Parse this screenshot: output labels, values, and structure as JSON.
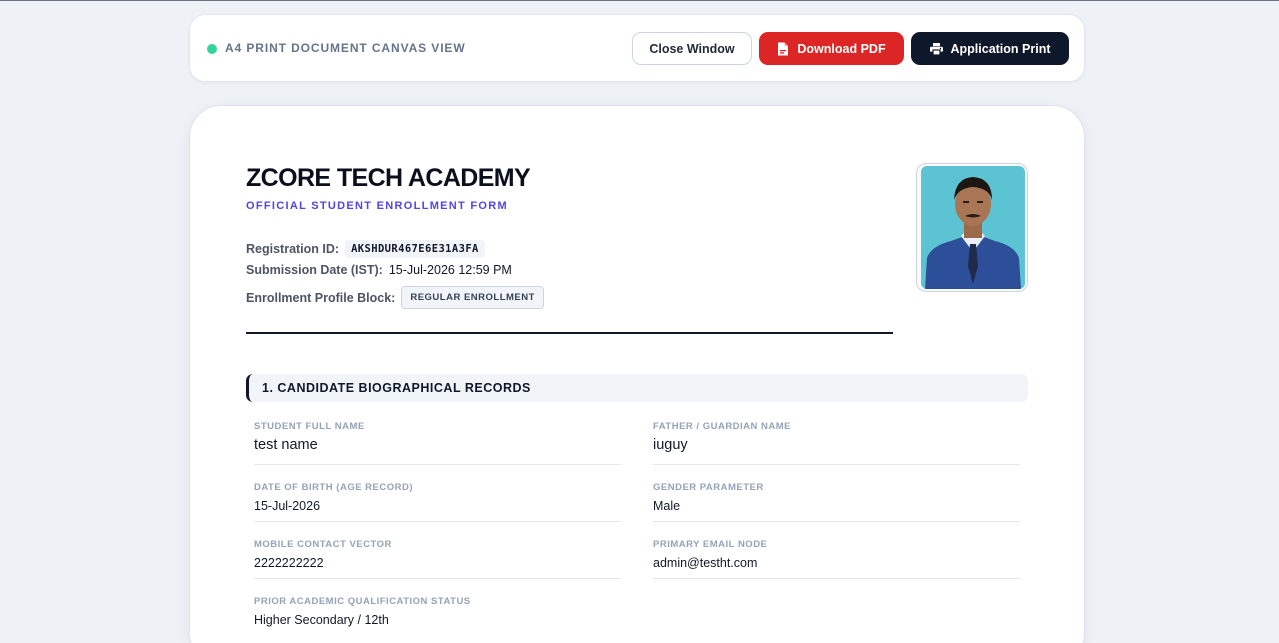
{
  "toolbar": {
    "title": "A4 PRINT DOCUMENT CANVAS VIEW",
    "status_color": "#34d399",
    "close_label": "Close Window",
    "pdf_label": "Download PDF",
    "print_label": "Application Print",
    "pdf_icon": "pdf-file-icon",
    "print_icon": "printer-icon"
  },
  "document": {
    "academy_name": "ZCORE TECH ACADEMY",
    "form_subtitle": "OFFICIAL STUDENT ENROLLMENT FORM",
    "registration_id_label": "Registration ID:",
    "registration_id": "AKSHDUR467E6E31A3FA",
    "submission_date_label": "Submission Date (IST):",
    "submission_date": "15-Jul-2026 12:59 PM",
    "enrollment_block_label": "Enrollment Profile Block:",
    "enrollment_block": "REGULAR ENROLLMENT",
    "photo": "student-photo"
  },
  "section1": {
    "title": "1. CANDIDATE BIOGRAPHICAL RECORDS",
    "fields": [
      {
        "label": "STUDENT FULL NAME",
        "value": "test name"
      },
      {
        "label": "FATHER / GUARDIAN NAME",
        "value": "iuguy"
      },
      {
        "label": "DATE OF BIRTH (AGE RECORD)",
        "value": "15-Jul-2026"
      },
      {
        "label": "GENDER PARAMETER",
        "value": "Male"
      },
      {
        "label": "MOBILE CONTACT VECTOR",
        "value": "2222222222"
      },
      {
        "label": "PRIMARY EMAIL NODE",
        "value": "admin@testht.com"
      },
      {
        "label": "PRIOR ACADEMIC QUALIFICATION STATUS",
        "value": "Higher Secondary / 12th"
      }
    ]
  },
  "colors": {
    "accent_indigo": "#4f46e5",
    "pdf_red": "#dc2626",
    "print_navy": "#0f172a"
  }
}
